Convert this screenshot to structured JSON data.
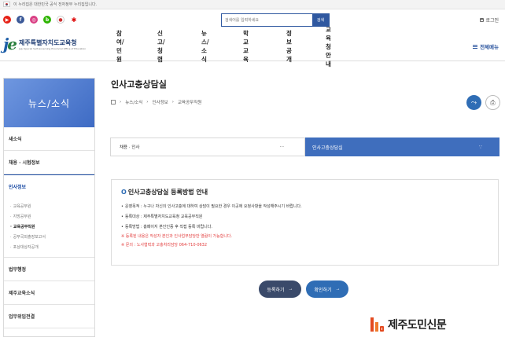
{
  "gov_banner": {
    "text": "이 누리집은 대한민국 공식 전자정부 누리집입니다."
  },
  "util": {
    "search_placeholder": "검색어를 입력하세요",
    "search_button": "검색",
    "login": "로그인"
  },
  "logo": {
    "mark": "je",
    "name_ko": "제주특별자치도교육청",
    "name_en": "Jeju Special Self-Governing Provincial Office of Education"
  },
  "gnb": {
    "items": [
      "참여/민원",
      "신고/청렴",
      "뉴스/소식",
      "학교교육",
      "정보공개",
      "교육청안내"
    ],
    "all_menu": "전체메뉴"
  },
  "sidebar": {
    "title": "뉴스/소식",
    "items": [
      "새소식",
      "채용 · 시험정보",
      "인사정보",
      "법무행정",
      "제주교육소식",
      "업무위임전결"
    ],
    "sub_items": [
      "교육공무원",
      "지방공무원",
      "교육공무직원",
      "공무국외출장보고서",
      "포상대상자공개"
    ],
    "active_item": "인사정보",
    "active_sub": "교육공무직원"
  },
  "main": {
    "title": "인사고충상담실",
    "breadcrumb": [
      "뉴스/소식",
      "인사정보",
      "교육공무직원"
    ],
    "select_left": "채용 · 인사",
    "select_left_more": "···",
    "select_right": "인사고충상담실",
    "select_right_icon": "∵"
  },
  "info": {
    "title": "인사고충상담실 등록방법 안내",
    "lines": [
      "운영목적 : 누구나 자신의 인사고충에 대하여 상담이 필요한 경우 이곳에 요청사항을 작성해주시기 바랍니다.",
      "등록대상 : 제주특별자치도교육청 교육공무직원",
      "등록방법 : 홈페이지 본인인증 후 직접 등록 바랍니다."
    ],
    "warnings": [
      "※ 등록된 내용은 작성자 본인과 인사업무담당만 열람이 가능합니다.",
      "※ 문의 : 노사협력과 고충처리담당 064-710-0632"
    ]
  },
  "buttons": {
    "register": "등록하기",
    "confirm": "확인하기",
    "arrow": "→"
  },
  "watermark": {
    "text": "제주도민신문"
  },
  "colors": {
    "primary": "#2f58a0",
    "sidebar_title": "#4a78cc",
    "select_active": "#3f6ebd",
    "warning": "#e23c3c"
  }
}
